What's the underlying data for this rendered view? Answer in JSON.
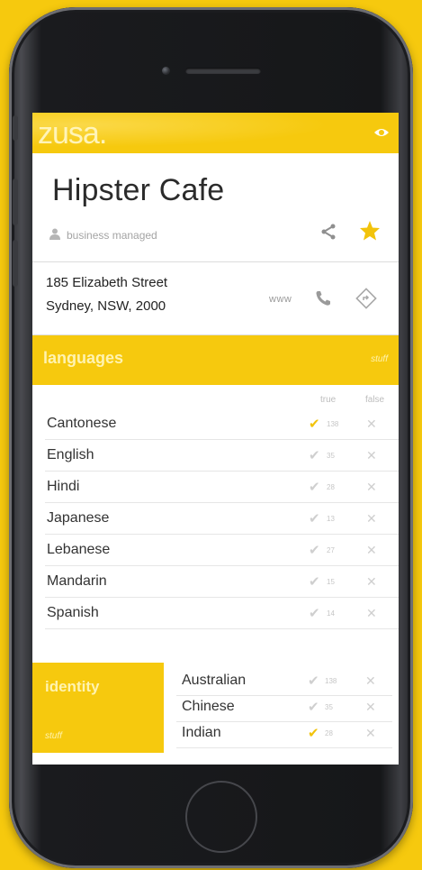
{
  "app": {
    "logo_text": "zusa."
  },
  "place": {
    "title": "Hipster Cafe",
    "managed_label": "business managed",
    "address_line1": "185 Elizabeth Street",
    "address_line2": "Sydney, NSW, 2000",
    "www_label": "www"
  },
  "languages": {
    "title": "languages",
    "action_label": "stuff",
    "col_true": "true",
    "col_false": "false",
    "items": [
      {
        "name": "Cantonese",
        "count": "138",
        "checked": true
      },
      {
        "name": "English",
        "count": "35",
        "checked": false
      },
      {
        "name": "Hindi",
        "count": "28",
        "checked": false
      },
      {
        "name": "Japanese",
        "count": "13",
        "checked": false
      },
      {
        "name": "Lebanese",
        "count": "27",
        "checked": false
      },
      {
        "name": "Mandarin",
        "count": "15",
        "checked": false
      },
      {
        "name": "Spanish",
        "count": "14",
        "checked": false
      }
    ]
  },
  "identity": {
    "title": "identity",
    "action_label": "stuff",
    "items": [
      {
        "name": "Australian",
        "count": "138",
        "checked": false
      },
      {
        "name": "Chinese",
        "count": "35",
        "checked": false
      },
      {
        "name": "Indian",
        "count": "28",
        "checked": true
      }
    ]
  },
  "icons": [
    "eye-icon",
    "person-icon",
    "share-icon",
    "star-icon",
    "phone-icon",
    "directions-icon",
    "check-icon",
    "cross-icon"
  ],
  "colors": {
    "accent": "#f6c90e",
    "accent_text": "#fff3b0",
    "text": "#333333",
    "muted": "#c6c6c6"
  }
}
